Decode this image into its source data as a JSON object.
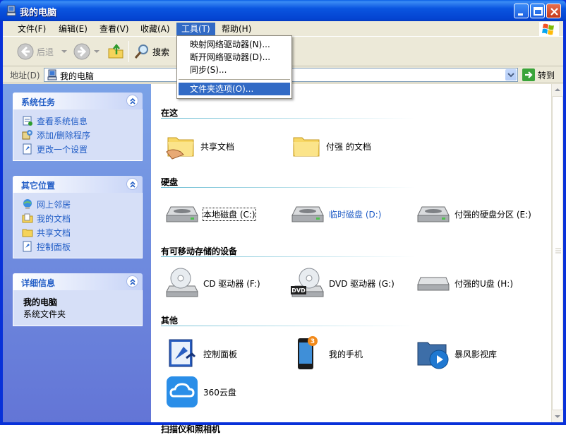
{
  "window": {
    "title": "我的电脑"
  },
  "menu": [
    "文件(F)",
    "编辑(E)",
    "查看(V)",
    "收藏(A)",
    "工具(T)",
    "帮助(H)"
  ],
  "tools_menu": {
    "items": [
      "映射网络驱动器(N)...",
      "断开网络驱动器(D)...",
      "同步(S)...",
      "文件夹选项(O)..."
    ]
  },
  "toolbar": {
    "back": "后退",
    "search": "搜索"
  },
  "address": {
    "label": "地址(D)",
    "value": "我的电脑",
    "go": "转到"
  },
  "panels": {
    "system": {
      "title": "系统任务",
      "items": [
        "查看系统信息",
        "添加/删除程序",
        "更改一个设置"
      ]
    },
    "other": {
      "title": "其它位置",
      "items": [
        "网上邻居",
        "我的文档",
        "共享文档",
        "控制面板"
      ]
    },
    "details": {
      "title": "详细信息",
      "name": "我的电脑",
      "desc": "系统文件夹"
    }
  },
  "groups": {
    "stored": {
      "title": "在这",
      "items": [
        "共享文档",
        "付强 的文档"
      ]
    },
    "disks": {
      "title": "硬盘",
      "items": [
        "本地磁盘 (C:)",
        "临时磁盘 (D:)",
        "付强的硬盘分区 (E:)"
      ]
    },
    "removable": {
      "title": "有可移动存储的设备",
      "items": [
        "CD 驱动器 (F:)",
        "DVD 驱动器 (G:)",
        "付强的U盘 (H:)"
      ]
    },
    "other": {
      "title": "其他",
      "items": [
        "控制面板",
        "我的手机",
        "暴风影视库",
        "360云盘"
      ]
    },
    "scanners": {
      "title": "扫描仪和照相机"
    }
  },
  "badges": {
    "phone": "3",
    "dvd": "DVD"
  },
  "colors": {
    "title_bar": "#0a55e0",
    "menu_highlight": "#316ac5",
    "task_link": "#215dc6",
    "left_pane_top": "#7ba2e7",
    "left_pane_bottom": "#6375d6"
  }
}
